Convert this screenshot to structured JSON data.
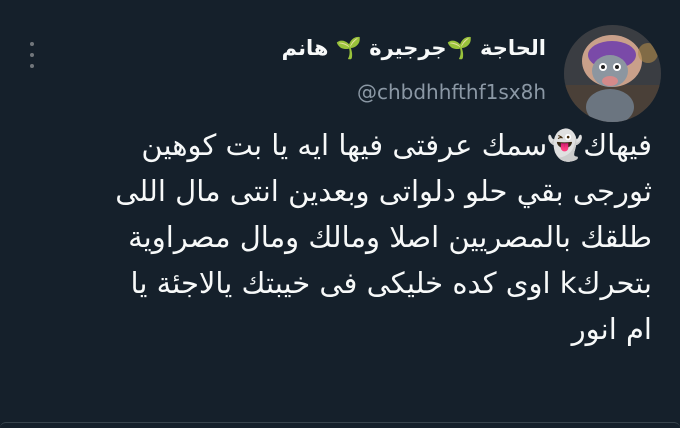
{
  "tweet": {
    "author": {
      "display_name": "الحاجة 🌱جرجيرة 🌱 هانم",
      "handle": "@chbdhhfthf1sx8h",
      "avatar_icon": "avatar-icon"
    },
    "more_icon": "more-icon",
    "text_lines": [
      "فيهاك👻سمك عرفتى فيها ايه يا بت كوهين",
      "ثورجى بقي حلو دلواتى وبعدين انتى مال اللى",
      "طلقك بالمصريين اصلا ومالك ومال مصراوية",
      "بتحركk اوى كده خليكى فى خيبتك يالاجئة يا",
      "ام انور"
    ]
  },
  "colors": {
    "background": "#15202b",
    "text": "#f7f9f9",
    "secondary_text": "#8b98a5",
    "border": "#38444d"
  }
}
